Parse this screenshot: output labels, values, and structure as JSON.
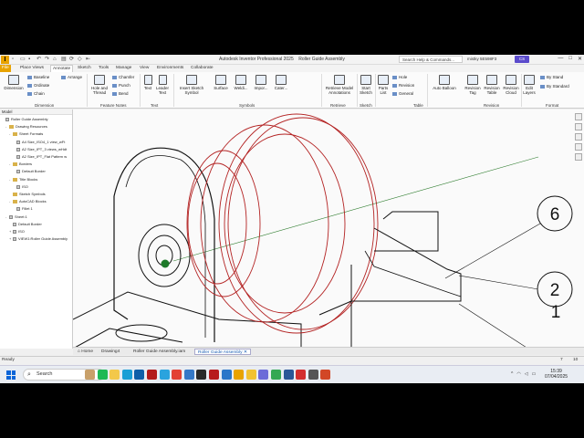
{
  "titlebar": {
    "logo": "I",
    "app_title": "Autodesk Inventor Professional 2025",
    "document": "Roller Guide Assembly",
    "search_placeholder": "Search Help & Commands...",
    "user": "mistky 5E598F3",
    "badge": "CS",
    "controls": [
      "—",
      "□",
      "✕"
    ]
  },
  "tabs": [
    "File",
    "Place Views",
    "Annotate",
    "Sketch",
    "Tools",
    "Manage",
    "View",
    "Environments",
    "Collaborate"
  ],
  "active_tab": "Annotate",
  "ribbon": {
    "dimension": {
      "big": "Dimension",
      "items": [
        "Baseline",
        "Ordinate",
        "Chain"
      ],
      "arrange": "Arrange",
      "panel": "Dimension"
    },
    "feature_notes": {
      "items": [
        "Chamfer",
        "Punch",
        "Bend"
      ],
      "big": "Hole and Thread",
      "panel": "Feature Notes"
    },
    "text": {
      "items": [
        "Text",
        "Leader Text"
      ],
      "panel": "Text"
    },
    "symbols": {
      "items": [
        "Insert Sketch Symbol",
        "Surface",
        "Weldi...",
        "Impor...",
        "Cater..."
      ],
      "panel": "Symbols"
    },
    "retrieve": {
      "big": "Retrieve Model Annotations",
      "panel": "Retrieve"
    },
    "sketch": {
      "big": "Start Sketch",
      "panel": "Sketch"
    },
    "table": {
      "big": "Parts List",
      "items": [
        "Hole",
        "Revision",
        "General"
      ],
      "panel": "Table"
    },
    "balloon": {
      "big": "Auto Balloon"
    },
    "revision": {
      "items": [
        "Revision Tag",
        "Revision Table",
        "Revision Cloud"
      ],
      "panel": "Revision"
    },
    "layers": {
      "big": "Edit Layers"
    },
    "format": {
      "items": [
        "By Stand",
        "By Standard"
      ],
      "panel": "Format"
    }
  },
  "browser": {
    "header": "Model",
    "nodes": [
      {
        "label": "Roller Guide Assembly",
        "level": 0,
        "toggle": "",
        "type": "doc"
      },
      {
        "label": "Drawing Resources",
        "level": 1,
        "toggle": "-",
        "type": "folder"
      },
      {
        "label": "Sheet Formats",
        "level": 2,
        "toggle": "-",
        "type": "folder"
      },
      {
        "label": "A4 Size_ISO4_1 view_wFt",
        "level": 3,
        "toggle": "",
        "type": "doc"
      },
      {
        "label": "A2 Size_IPT_3 views_wHdt",
        "level": 3,
        "toggle": "",
        "type": "doc"
      },
      {
        "label": "A2 Size_IPT_Flat Pattern w",
        "level": 3,
        "toggle": "",
        "type": "doc"
      },
      {
        "label": "Borders",
        "level": 2,
        "toggle": "-",
        "type": "folder"
      },
      {
        "label": "Default Border",
        "level": 3,
        "toggle": "",
        "type": "doc"
      },
      {
        "label": "Title Blocks",
        "level": 2,
        "toggle": "-",
        "type": "folder"
      },
      {
        "label": "ISO",
        "level": 3,
        "toggle": "",
        "type": "doc"
      },
      {
        "label": "Sketch Symbols",
        "level": 2,
        "toggle": "",
        "type": "folder"
      },
      {
        "label": "AutoCAD Blocks",
        "level": 2,
        "toggle": "-",
        "type": "folder"
      },
      {
        "label": "Fillet 1",
        "level": 3,
        "toggle": "",
        "type": "doc"
      },
      {
        "label": "Sheet:1",
        "level": 1,
        "toggle": "-",
        "type": "doc"
      },
      {
        "label": "Default Border",
        "level": 2,
        "toggle": "",
        "type": "doc"
      },
      {
        "label": "ISO",
        "level": 2,
        "toggle": "+",
        "type": "doc"
      },
      {
        "label": "VIEW1:Roller Guide Assembly",
        "level": 2,
        "toggle": "+",
        "type": "doc"
      }
    ]
  },
  "balloons": [
    {
      "label": "6"
    },
    {
      "label": "2"
    },
    {
      "label": "1"
    }
  ],
  "doc_tabs": [
    "Home",
    "Drawing4",
    "Roller Guide Assembly.iam",
    "Roller Guide Assembly"
  ],
  "active_doc_tab": "Roller Guide Assembly",
  "status": {
    "left": "Ready",
    "right1": "7",
    "right2": "10"
  },
  "taskbar": {
    "search_label": "Search",
    "time": "15:39",
    "date": "07/04/2025",
    "icons": [
      {
        "name": "widget-icon",
        "color": "#c8a06a"
      },
      {
        "name": "spotify-icon",
        "color": "#1db954"
      },
      {
        "name": "explorer-icon",
        "color": "#f3c84a"
      },
      {
        "name": "edge-icon",
        "color": "#1a9fd6"
      },
      {
        "name": "outlook-icon",
        "color": "#0f5fa8"
      },
      {
        "name": "store-icon",
        "color": "#b31b1b"
      },
      {
        "name": "telegram-icon",
        "color": "#2aa3de"
      },
      {
        "name": "chrome-icon",
        "color": "#e34133"
      },
      {
        "name": "photos-icon",
        "color": "#3478c7"
      },
      {
        "name": "app-icon",
        "color": "#2a2a2a"
      },
      {
        "name": "game-icon",
        "color": "#b71c1c"
      },
      {
        "name": "box-icon",
        "color": "#2a77c9"
      },
      {
        "name": "inventor-icon",
        "color": "#e8a300"
      },
      {
        "name": "folder-icon",
        "color": "#f1c232"
      },
      {
        "name": "snip-icon",
        "color": "#6b6bd8"
      },
      {
        "name": "chrome2-icon",
        "color": "#34a853"
      },
      {
        "name": "word-icon",
        "color": "#2b5797"
      },
      {
        "name": "acrobat-icon",
        "color": "#d32f2f"
      },
      {
        "name": "printer-icon",
        "color": "#555555"
      },
      {
        "name": "powerpoint-icon",
        "color": "#d24726"
      }
    ]
  }
}
